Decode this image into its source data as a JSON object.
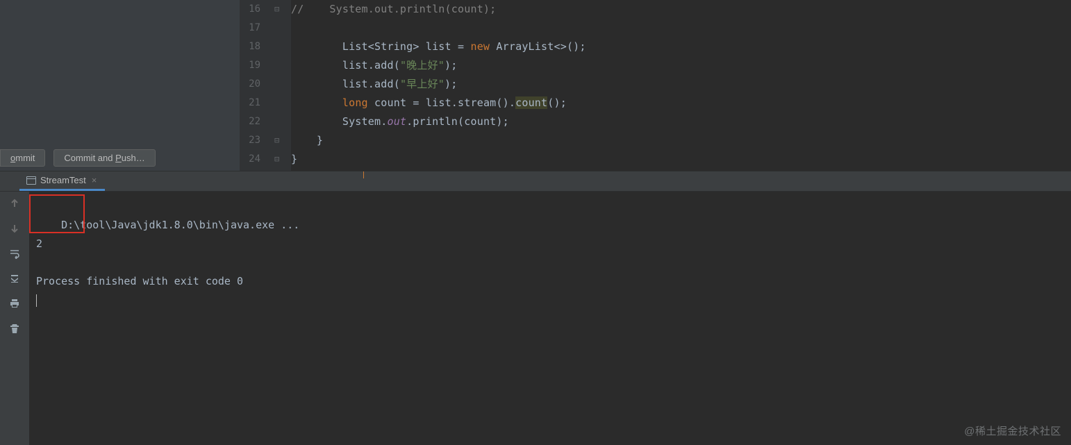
{
  "editor": {
    "lines": [
      {
        "num": "16",
        "fold": "⊟",
        "tokens": [
          {
            "cls": "c-comment",
            "txt": "//    System.out.println(count);"
          }
        ]
      },
      {
        "num": "17",
        "fold": "",
        "tokens": []
      },
      {
        "num": "18",
        "fold": "",
        "tokens": [
          {
            "cls": "",
            "txt": "        List<String> list = "
          },
          {
            "cls": "c-keyword",
            "txt": "new"
          },
          {
            "cls": "",
            "txt": " ArrayList<>();"
          }
        ]
      },
      {
        "num": "19",
        "fold": "",
        "tokens": [
          {
            "cls": "",
            "txt": "        list.add("
          },
          {
            "cls": "c-string",
            "txt": "\"晚上好\""
          },
          {
            "cls": "",
            "txt": ");"
          }
        ]
      },
      {
        "num": "20",
        "fold": "",
        "tokens": [
          {
            "cls": "",
            "txt": "        list.add("
          },
          {
            "cls": "c-string",
            "txt": "\"早上好\""
          },
          {
            "cls": "",
            "txt": ");"
          }
        ]
      },
      {
        "num": "21",
        "fold": "",
        "tokens": [
          {
            "cls": "",
            "txt": "        "
          },
          {
            "cls": "c-keyword",
            "txt": "long"
          },
          {
            "cls": "",
            "txt": " count = list.stream()."
          },
          {
            "cls": "c-hl",
            "txt": "count"
          },
          {
            "cls": "",
            "txt": "();"
          }
        ]
      },
      {
        "num": "22",
        "fold": "",
        "tokens": [
          {
            "cls": "",
            "txt": "        System."
          },
          {
            "cls": "c-field",
            "txt": "out"
          },
          {
            "cls": "",
            "txt": ".println(count);"
          }
        ]
      },
      {
        "num": "23",
        "fold": "⊟",
        "tokens": [
          {
            "cls": "",
            "txt": "    }"
          }
        ]
      },
      {
        "num": "24",
        "fold": "⊟",
        "tokens": [
          {
            "cls": "",
            "txt": "}"
          }
        ]
      }
    ]
  },
  "commit": {
    "commit_label_pre": "",
    "commit_label_key": "o",
    "commit_label_post": "mmit",
    "push_label_pre": "Commit and ",
    "push_label_key": "P",
    "push_label_post": "ush…"
  },
  "run": {
    "tab_label": "StreamTest",
    "tab_close": "×"
  },
  "console": {
    "line_cmd": "D:\\tool\\Java\\jdk1.8.0\\bin\\java.exe ...",
    "line_out": "2",
    "line_blank": "",
    "line_exit": "Process finished with exit code 0"
  },
  "watermark": "@稀土掘金技术社区"
}
